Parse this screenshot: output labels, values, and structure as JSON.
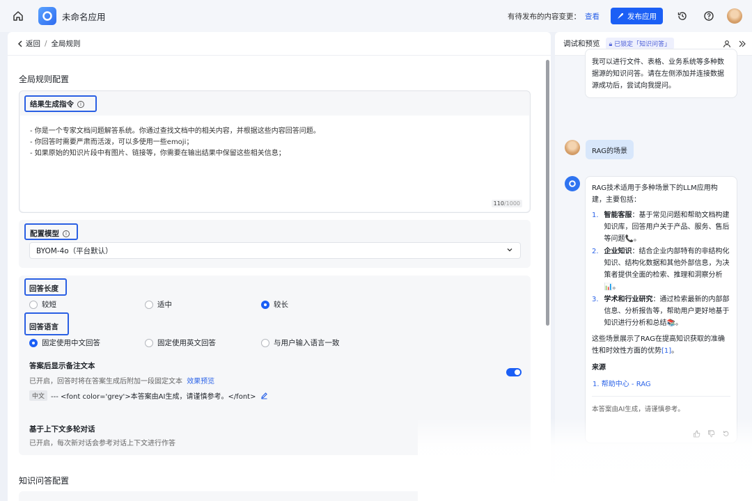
{
  "topbar": {
    "app_name": "未命名应用",
    "pending_label": "有待发布的内容变更：",
    "view_link": "查看",
    "publish_label": "发布应用"
  },
  "left": {
    "back_label": "返回",
    "breadcrumb_current": "全局规则",
    "section_title": "全局规则配置",
    "prompt": {
      "label": "结果生成指令",
      "lines": [
        "- 你是一个专家文档问题解答系统。你通过查找文档中的相关内容，并根据这些内容回答问题。",
        "- 你回答时需要严肃而活泼，可以多使用一些emoji；",
        "- 如果原始的知识片段中有图片、链接等，你需要在输出结果中保留这些相关信息；"
      ],
      "counter_current": "110",
      "counter_max": "/1000"
    },
    "model": {
      "label": "配置模型",
      "selected": "BYOM-4o（平台默认）"
    },
    "length": {
      "label": "回答长度",
      "options": [
        "较短",
        "适中",
        "较长"
      ],
      "selected": "较长"
    },
    "language": {
      "label": "回答语言",
      "options": [
        "固定使用中文回答",
        "固定使用英文回答",
        "与用户输入语言一致"
      ],
      "selected": "固定使用中文回答"
    },
    "note": {
      "title": "答案后显示备注文本",
      "desc": "已开启，回答时将在答案生成后附加一段固定文本",
      "preview_link": "效果预览",
      "lang_tag": "中文",
      "text": "--- <font color='grey'>本答案由AI生成，请谨慎参考。</font>",
      "enabled": true
    },
    "multiturn": {
      "title": "基于上下文多轮对话",
      "desc": "已开启，每次新对话会参考对话上下文进行作答"
    },
    "kb_section_title": "知识问答配置"
  },
  "right": {
    "title": "调试和预览",
    "lock_badge": "已锁定「知识问答」",
    "intro_lines": [
      "我可以进行文件、表格、业务系统等多种数",
      "据源的知识问答。请在左侧添加并连接数据",
      "源成功后，尝试向我提问。"
    ],
    "user_question": "RAG的场景",
    "answer": {
      "intro_lines": [
        "RAG技术适用于多种场景下的LLM应用构",
        "建，主要包括："
      ],
      "items": [
        {
          "num": "1.",
          "title": "智能客服",
          "lines": [
            "：基于常见问题和帮助文档构建",
            "知识库，回答用户关于产品、服务、售后",
            "等问题📞。"
          ]
        },
        {
          "num": "2.",
          "title": "企业知识",
          "lines": [
            "：结合企业内部特有的非结构化",
            "知识、结构化数据和其他外部信息，为决",
            "策者提供全面的检索、推理和洞察分析",
            "📊。"
          ]
        },
        {
          "num": "3.",
          "title": "学术和行业研究",
          "lines": [
            "：通过检索最新的内部部",
            "信息、分析报告等，帮助用户更好地基于",
            "知识进行分析和总结📚。"
          ]
        }
      ],
      "summary_lines": [
        "这些场景展示了RAG在提高知识获取的准确",
        "性和时效性方面的优势"
      ],
      "cite": "[1]",
      "summary_end": "。",
      "source_title": "来源",
      "source_num": "1.",
      "source_link": "帮助中心 - RAG",
      "disclaimer": "本答案由AI生成，请谨慎参考。"
    }
  }
}
